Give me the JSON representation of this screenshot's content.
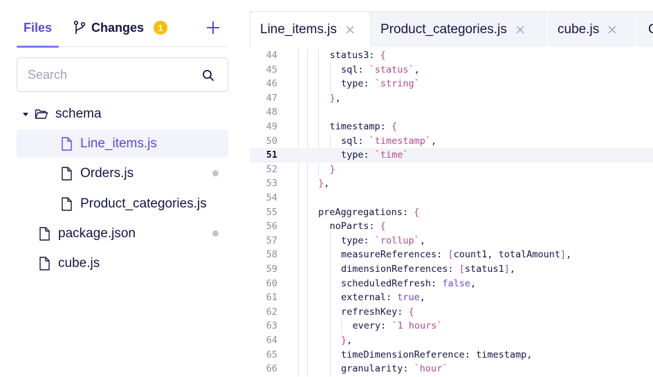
{
  "sidebar": {
    "tabs": {
      "files": "Files",
      "changes": "Changes",
      "changes_count": "1"
    },
    "search": {
      "placeholder": "Search"
    },
    "tree": [
      {
        "label": "schema",
        "kind": "folder",
        "depth": 0,
        "expanded": true,
        "active": false,
        "modified": false
      },
      {
        "label": "Line_items.js",
        "kind": "file",
        "depth": 1,
        "active": true,
        "modified": false
      },
      {
        "label": "Orders.js",
        "kind": "file",
        "depth": 1,
        "active": false,
        "modified": true
      },
      {
        "label": "Product_categories.js",
        "kind": "file",
        "depth": 1,
        "active": false,
        "modified": false
      },
      {
        "label": "package.json",
        "kind": "file",
        "depth": 0,
        "active": false,
        "modified": true
      },
      {
        "label": "cube.js",
        "kind": "file",
        "depth": 0,
        "active": false,
        "modified": false
      }
    ]
  },
  "editor": {
    "tabs": [
      {
        "label": "Line_items.js",
        "active": true
      },
      {
        "label": "Product_categories.js",
        "active": false
      },
      {
        "label": "cube.js",
        "active": false
      },
      {
        "label": "C",
        "active": false
      }
    ],
    "current_line": "51",
    "lines": [
      {
        "n": "44",
        "indent": 1,
        "tokens": [
          [
            "plain",
            "status3: "
          ],
          [
            "pun",
            "{"
          ]
        ]
      },
      {
        "n": "45",
        "indent": 2,
        "tokens": [
          [
            "plain",
            "sql: "
          ],
          [
            "str",
            "`status`"
          ],
          [
            "plain",
            ","
          ]
        ]
      },
      {
        "n": "46",
        "indent": 2,
        "tokens": [
          [
            "plain",
            "type: "
          ],
          [
            "str",
            "`string`"
          ]
        ]
      },
      {
        "n": "47",
        "indent": 1,
        "tokens": [
          [
            "pun",
            "}"
          ],
          [
            "plain",
            ","
          ]
        ]
      },
      {
        "n": "48",
        "indent": 1,
        "tokens": []
      },
      {
        "n": "49",
        "indent": 1,
        "tokens": [
          [
            "plain",
            "timestamp: "
          ],
          [
            "pun",
            "{"
          ]
        ]
      },
      {
        "n": "50",
        "indent": 2,
        "tokens": [
          [
            "plain",
            "sql: "
          ],
          [
            "str",
            "`timestamp`"
          ],
          [
            "plain",
            ","
          ]
        ]
      },
      {
        "n": "51",
        "indent": 2,
        "tokens": [
          [
            "plain",
            "type: "
          ],
          [
            "str",
            "`time`"
          ]
        ]
      },
      {
        "n": "52",
        "indent": 1,
        "tokens": [
          [
            "pun",
            "}"
          ]
        ]
      },
      {
        "n": "53",
        "indent": 0,
        "tokens": [
          [
            "pun",
            "}"
          ],
          [
            "plain",
            ","
          ]
        ]
      },
      {
        "n": "54",
        "indent": 0,
        "tokens": []
      },
      {
        "n": "55",
        "indent": 0,
        "tokens": [
          [
            "plain",
            "preAggregations: "
          ],
          [
            "pun",
            "{"
          ]
        ]
      },
      {
        "n": "56",
        "indent": 1,
        "tokens": [
          [
            "plain",
            "noParts: "
          ],
          [
            "pun",
            "{"
          ]
        ]
      },
      {
        "n": "57",
        "indent": 2,
        "tokens": [
          [
            "plain",
            "type: "
          ],
          [
            "str",
            "`rollup`"
          ],
          [
            "plain",
            ","
          ]
        ]
      },
      {
        "n": "58",
        "indent": 2,
        "tokens": [
          [
            "plain",
            "measureReferences: "
          ],
          [
            "pun",
            "["
          ],
          [
            "plain",
            "count1, totalAmount"
          ],
          [
            "pun",
            "]"
          ],
          [
            "plain",
            ","
          ]
        ]
      },
      {
        "n": "59",
        "indent": 2,
        "tokens": [
          [
            "plain",
            "dimensionReferences: "
          ],
          [
            "pun",
            "["
          ],
          [
            "plain",
            "status1"
          ],
          [
            "pun",
            "]"
          ],
          [
            "plain",
            ","
          ]
        ]
      },
      {
        "n": "60",
        "indent": 2,
        "tokens": [
          [
            "plain",
            "scheduledRefresh: "
          ],
          [
            "kw",
            "false"
          ],
          [
            "plain",
            ","
          ]
        ]
      },
      {
        "n": "61",
        "indent": 2,
        "tokens": [
          [
            "plain",
            "external: "
          ],
          [
            "kw",
            "true"
          ],
          [
            "plain",
            ","
          ]
        ]
      },
      {
        "n": "62",
        "indent": 2,
        "tokens": [
          [
            "plain",
            "refreshKey: "
          ],
          [
            "pun",
            "{"
          ]
        ]
      },
      {
        "n": "63",
        "indent": 3,
        "tokens": [
          [
            "plain",
            "every: "
          ],
          [
            "str",
            "`1 hours`"
          ]
        ]
      },
      {
        "n": "64",
        "indent": 2,
        "tokens": [
          [
            "pun",
            "}"
          ],
          [
            "plain",
            ","
          ]
        ]
      },
      {
        "n": "65",
        "indent": 2,
        "tokens": [
          [
            "plain",
            "timeDimensionReference: timestamp,"
          ]
        ]
      },
      {
        "n": "66",
        "indent": 2,
        "tokens": [
          [
            "plain",
            "granularity: "
          ],
          [
            "str",
            "`hour`"
          ]
        ]
      }
    ]
  },
  "icons": {
    "branch": "git-branch-icon",
    "plus": "plus-icon",
    "search": "search-icon",
    "folder": "folder-open-icon",
    "file": "file-icon",
    "close": "close-icon",
    "caret": "caret-down-icon"
  },
  "colors": {
    "accent": "#5a48e8",
    "badge": "#fbbc05",
    "string": "#b04b8c",
    "keyword": "#6a4ad8"
  }
}
